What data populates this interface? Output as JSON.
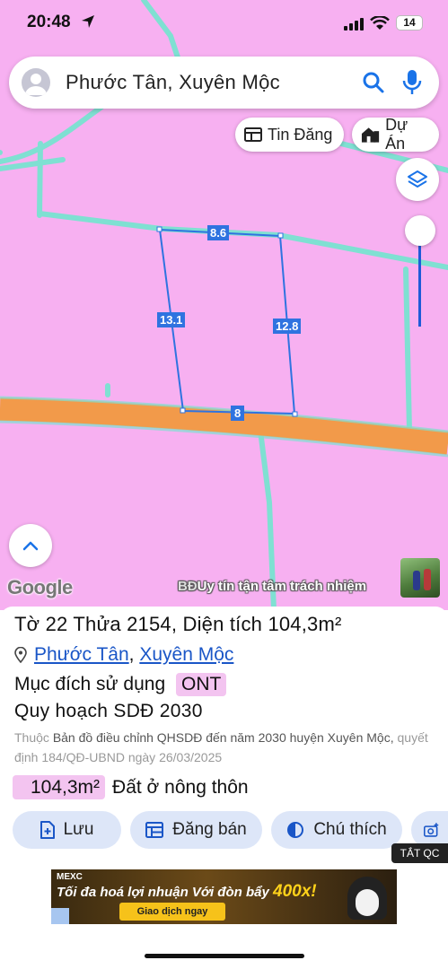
{
  "status_bar": {
    "time": "20:48",
    "battery": "14"
  },
  "search": {
    "query": "Phước Tân, Xuyên Mộc"
  },
  "map_buttons": {
    "listings_label": "Tin Đăng",
    "projects_label": "Dự Án"
  },
  "map": {
    "parcel_edges": {
      "top": "8.6",
      "left": "13.1",
      "right": "12.8",
      "bottom": "8"
    },
    "attribution": "Google",
    "watermark_prefix": "BĐ",
    "watermark": "Uy tín tận tâm trách nhiệm",
    "colors": {
      "land": "#f7b0f1",
      "road": "#f29a4a",
      "boundary": "#7fe0d2",
      "parcel_outline": "#2f73e0"
    }
  },
  "parcel": {
    "title_prefix": "Tờ",
    "sheet": "22",
    "plot_label": "Thửa",
    "plot": "2154",
    "area_label": "Diện tích",
    "area": "104,3m²",
    "ward": "Phước Tân",
    "district": "Xuyên Mộc",
    "purpose_label": "Mục đích sử dụng",
    "purpose_code": "ONT",
    "plan_label": "Quy hoạch SDĐ 2030",
    "source_prefix": "Thuộc",
    "source_text": "Bản đồ điều chỉnh QHSDĐ đến năm 2030 huyện Xuyên Mộc,",
    "decision_text": "quyết định 184/QĐ-UBND ngày 26/03/2025",
    "area_value": "104,3m²",
    "land_type": "Đất ở nông thôn"
  },
  "actions": {
    "save": "Lưu",
    "post_sale": "Đăng bán",
    "legend": "Chú thích"
  },
  "ad": {
    "close_label": "TẮT QC",
    "brand": "MEXC",
    "headline": "Tối đa hoá lợi nhuận Với đòn bẩy",
    "highlight": "400x!",
    "cta": "Giao dịch ngay"
  }
}
